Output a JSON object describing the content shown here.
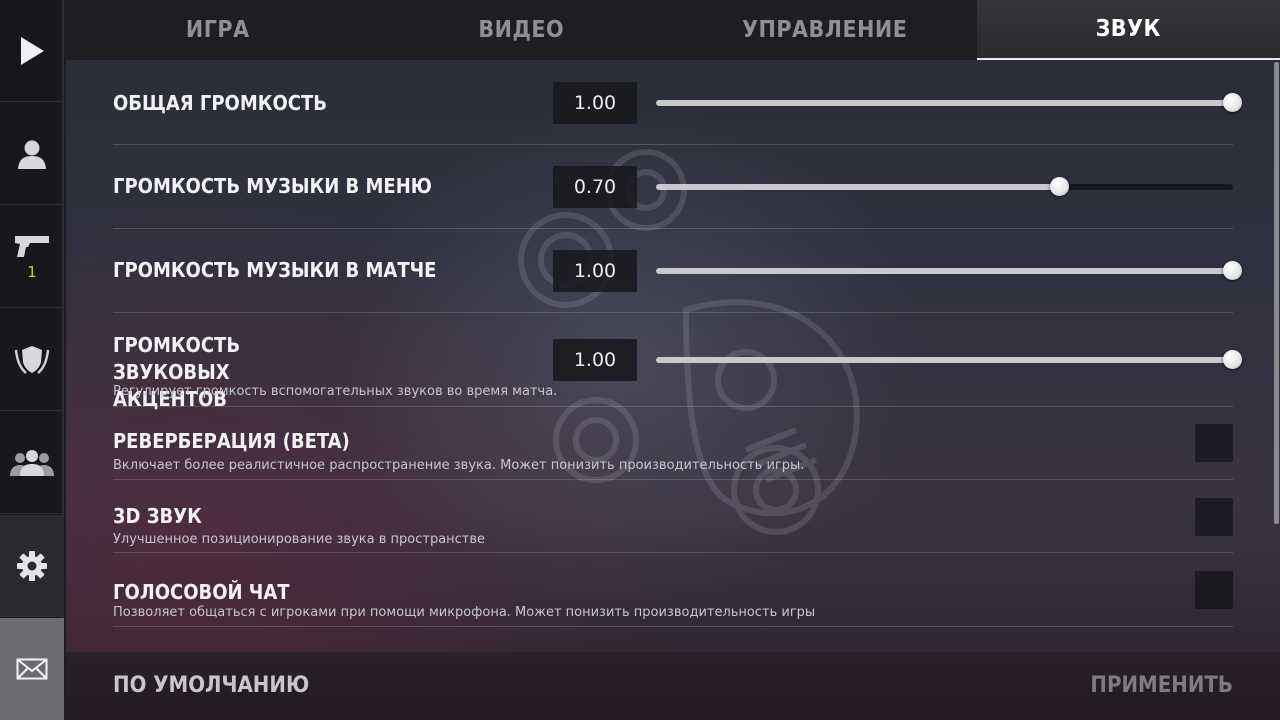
{
  "rail": {
    "items": [
      {
        "icon": "play-icon"
      },
      {
        "icon": "profile-icon"
      },
      {
        "icon": "pistol-icon",
        "badge": "1"
      },
      {
        "icon": "rank-shield-icon"
      },
      {
        "icon": "friends-icon"
      },
      {
        "icon": "gear-icon"
      },
      {
        "icon": "mail-icon"
      }
    ]
  },
  "tabs": [
    {
      "label": "ИГРА"
    },
    {
      "label": "ВИДЕО"
    },
    {
      "label": "УПРАВЛЕНИЕ"
    },
    {
      "label": "ЗВУК",
      "active": true
    }
  ],
  "settings": {
    "master_volume": {
      "title": "ОБЩАЯ ГРОМКОСТЬ",
      "value": "1.00",
      "level": 1.0
    },
    "menu_music_volume": {
      "title": "ГРОМКОСТЬ МУЗЫКИ В МЕНЮ",
      "value": "0.70",
      "level": 0.7
    },
    "match_music_volume": {
      "title": "ГРОМКОСТЬ МУЗЫКИ В МАТЧЕ",
      "value": "1.00",
      "level": 1.0
    },
    "accent_volume": {
      "title": "ГРОМКОСТЬ ЗВУКОВЫХ АКЦЕНТОВ",
      "value": "1.00",
      "level": 1.0,
      "description": "Регулирует громкость вспомогательных звуков во время матча."
    },
    "reverb": {
      "title": "РЕВЕРБЕРАЦИЯ (BETA)",
      "description": "Включает более реалистичное распространение звука. Может понизить производительность игры.",
      "enabled": false
    },
    "sound_3d": {
      "title": "3D ЗВУК",
      "description": "Улучшенное позиционирование звука в пространстве",
      "enabled": false
    },
    "voice_chat": {
      "title": "ГОЛОСОВОЙ ЧАТ",
      "description": "Позволяет общаться с игроками при помощи микрофона. Может понизить производительность игры",
      "enabled": false
    }
  },
  "footer": {
    "default_label": "ПО УМОЛЧАНИЮ",
    "apply_label": "ПРИМЕНИТЬ"
  },
  "colors": {
    "accent_badge": "#e2b73a",
    "text_primary": "#f2f2f4",
    "text_muted": "#8f9096"
  }
}
